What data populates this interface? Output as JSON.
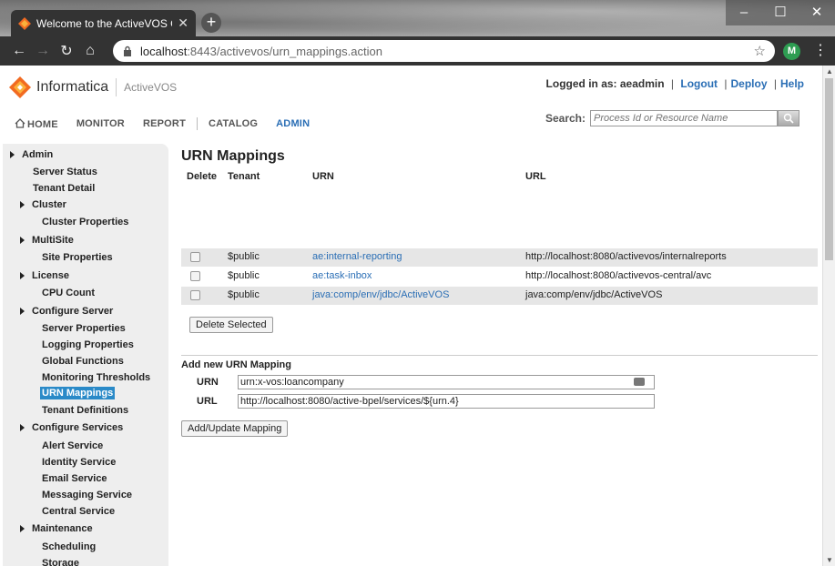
{
  "browser": {
    "tab_title": "Welcome to the ActiveVOS Cons",
    "url_host": "localhost",
    "url_path": ":8443/activevos/urn_mappings.action",
    "profile_initial": "M"
  },
  "header": {
    "brand": "Informatica",
    "product": "ActiveVOS",
    "logged_in_label": "Logged in as: aeadmin",
    "logout": "Logout",
    "deploy": "Deploy",
    "help": "Help"
  },
  "nav": {
    "home": "HOME",
    "monitor": "MONITOR",
    "report": "REPORT",
    "catalog": "CATALOG",
    "admin": "ADMIN"
  },
  "search": {
    "label": "Search:",
    "placeholder": "Process Id or Resource Name"
  },
  "sidebar": {
    "admin": "Admin",
    "server_status": "Server Status",
    "tenant_detail": "Tenant Detail",
    "cluster": "Cluster",
    "cluster_properties": "Cluster Properties",
    "multisite": "MultiSite",
    "site_properties": "Site Properties",
    "license": "License",
    "cpu_count": "CPU Count",
    "configure_server": "Configure Server",
    "server_properties": "Server Properties",
    "logging_properties": "Logging Properties",
    "global_functions": "Global Functions",
    "monitoring_thresholds": "Monitoring Thresholds",
    "urn_mappings": "URN Mappings",
    "tenant_definitions": "Tenant Definitions",
    "configure_services": "Configure Services",
    "alert_service": "Alert Service",
    "identity_service": "Identity Service",
    "email_service": "Email Service",
    "messaging_service": "Messaging Service",
    "central_service": "Central Service",
    "maintenance": "Maintenance",
    "scheduling": "Scheduling",
    "storage": "Storage"
  },
  "main": {
    "title": "URN Mappings",
    "columns": {
      "delete": "Delete",
      "tenant": "Tenant",
      "urn": "URN",
      "url": "URL"
    },
    "rows": [
      {
        "tenant": "$public",
        "urn": "ae:internal-reporting",
        "url": "http://localhost:8080/activevos/internalreports"
      },
      {
        "tenant": "$public",
        "urn": "ae:task-inbox",
        "url": "http://localhost:8080/activevos-central/avc"
      },
      {
        "tenant": "$public",
        "urn": "java:comp/env/jdbc/ActiveVOS",
        "url": "java:comp/env/jdbc/ActiveVOS"
      }
    ],
    "delete_button": "Delete Selected",
    "add_title": "Add new URN Mapping",
    "urn_label": "URN",
    "urn_value": "urn:x-vos:loancompany",
    "url_label": "URL",
    "url_value": "http://localhost:8080/active-bpel/services/${urn.4}",
    "add_button": "Add/Update Mapping"
  },
  "colors": {
    "accent": "#2a6eb5",
    "active_item": "#2a8ac8",
    "logo_orange": "#f26b21"
  }
}
